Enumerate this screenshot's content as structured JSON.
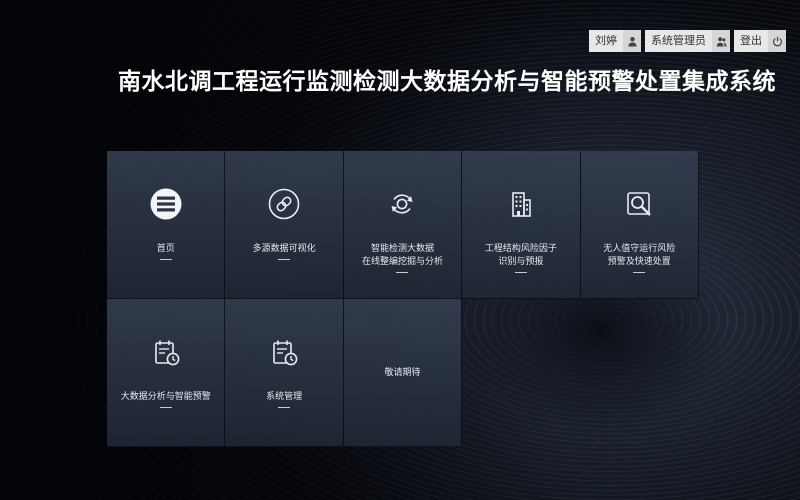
{
  "header": {
    "title": "南水北调工程运行监测检测大数据分析与智能预警处置集成系统",
    "user_name": "刘婷",
    "role": "系统管理员",
    "logout_label": "登出"
  },
  "tiles": [
    {
      "label": "首页",
      "icon": "list-icon"
    },
    {
      "label": "多源数据可视化",
      "icon": "link-icon"
    },
    {
      "label": "智能检测大数据\n在线整编挖掘与分析",
      "icon": "refresh-icon"
    },
    {
      "label": "工程结构风险因子\n识别与预报",
      "icon": "building-icon"
    },
    {
      "label": "无人值守运行风险\n预警及快速处置",
      "icon": "search-icon"
    },
    {
      "label": "大数据分析与智能预警",
      "icon": "calendar-clock-icon"
    },
    {
      "label": "系统管理",
      "icon": "calendar-clock-icon"
    },
    {
      "label": "敬请期待",
      "icon": ""
    }
  ]
}
